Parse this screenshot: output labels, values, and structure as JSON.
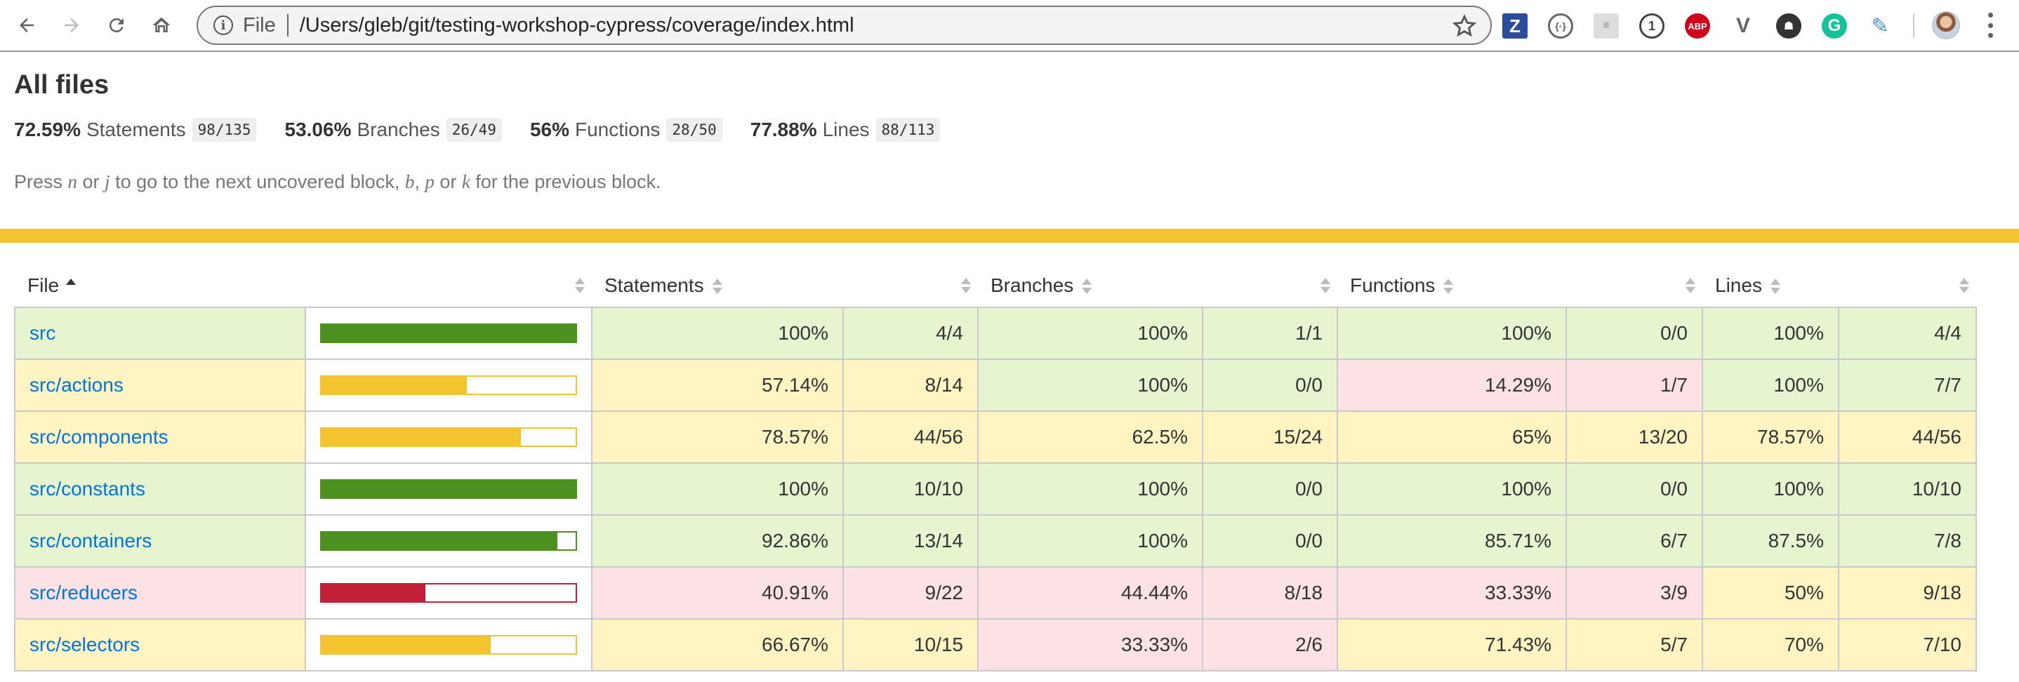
{
  "browser": {
    "scheme": "File",
    "url": "/Users/gleb/git/testing-workshop-cypress/coverage/index.html",
    "extensions": [
      "Z",
      "{·}",
      "≡",
      "1",
      "ABP",
      "V",
      "☗",
      "G",
      "✎"
    ]
  },
  "page": {
    "title": "All files",
    "summary": [
      {
        "pct": "72.59%",
        "label": "Statements",
        "fraction": "98/135"
      },
      {
        "pct": "53.06%",
        "label": "Branches",
        "fraction": "26/49"
      },
      {
        "pct": "56%",
        "label": "Functions",
        "fraction": "28/50"
      },
      {
        "pct": "77.88%",
        "label": "Lines",
        "fraction": "88/113"
      }
    ],
    "help": {
      "t1": "Press ",
      "k1": "n",
      "t2": " or ",
      "k2": "j",
      "t3": " to go to the next uncovered block, ",
      "k3": "b",
      "t4": ", ",
      "k4": "p",
      "t5": " or ",
      "k5": "k",
      "t6": " for the previous block."
    }
  },
  "table": {
    "headers": {
      "file": "File",
      "statements": "Statements",
      "branches": "Branches",
      "functions": "Functions",
      "lines": "Lines"
    },
    "rows": [
      {
        "file": "src",
        "bar_level": "high",
        "bar_pct": 100,
        "st": {
          "p": "100%",
          "f": "4/4",
          "c": "high"
        },
        "br": {
          "p": "100%",
          "f": "1/1",
          "c": "high"
        },
        "fn": {
          "p": "100%",
          "f": "0/0",
          "c": "high"
        },
        "ln": {
          "p": "100%",
          "f": "4/4",
          "c": "high"
        }
      },
      {
        "file": "src/actions",
        "bar_level": "medium",
        "bar_pct": 57.14,
        "st": {
          "p": "57.14%",
          "f": "8/14",
          "c": "medium"
        },
        "br": {
          "p": "100%",
          "f": "0/0",
          "c": "high"
        },
        "fn": {
          "p": "14.29%",
          "f": "1/7",
          "c": "low"
        },
        "ln": {
          "p": "100%",
          "f": "7/7",
          "c": "high"
        }
      },
      {
        "file": "src/components",
        "bar_level": "medium",
        "bar_pct": 78.57,
        "st": {
          "p": "78.57%",
          "f": "44/56",
          "c": "medium"
        },
        "br": {
          "p": "62.5%",
          "f": "15/24",
          "c": "medium"
        },
        "fn": {
          "p": "65%",
          "f": "13/20",
          "c": "medium"
        },
        "ln": {
          "p": "78.57%",
          "f": "44/56",
          "c": "medium"
        }
      },
      {
        "file": "src/constants",
        "bar_level": "high",
        "bar_pct": 100,
        "st": {
          "p": "100%",
          "f": "10/10",
          "c": "high"
        },
        "br": {
          "p": "100%",
          "f": "0/0",
          "c": "high"
        },
        "fn": {
          "p": "100%",
          "f": "0/0",
          "c": "high"
        },
        "ln": {
          "p": "100%",
          "f": "10/10",
          "c": "high"
        }
      },
      {
        "file": "src/containers",
        "bar_level": "high",
        "bar_pct": 92.86,
        "st": {
          "p": "92.86%",
          "f": "13/14",
          "c": "high"
        },
        "br": {
          "p": "100%",
          "f": "0/0",
          "c": "high"
        },
        "fn": {
          "p": "85.71%",
          "f": "6/7",
          "c": "high"
        },
        "ln": {
          "p": "87.5%",
          "f": "7/8",
          "c": "high"
        }
      },
      {
        "file": "src/reducers",
        "bar_level": "low",
        "bar_pct": 40.91,
        "st": {
          "p": "40.91%",
          "f": "9/22",
          "c": "low"
        },
        "br": {
          "p": "44.44%",
          "f": "8/18",
          "c": "low"
        },
        "fn": {
          "p": "33.33%",
          "f": "3/9",
          "c": "low"
        },
        "ln": {
          "p": "50%",
          "f": "9/18",
          "c": "medium"
        }
      },
      {
        "file": "src/selectors",
        "bar_level": "medium",
        "bar_pct": 66.67,
        "st": {
          "p": "66.67%",
          "f": "10/15",
          "c": "medium"
        },
        "br": {
          "p": "33.33%",
          "f": "2/6",
          "c": "low"
        },
        "fn": {
          "p": "71.43%",
          "f": "5/7",
          "c": "medium"
        },
        "ln": {
          "p": "70%",
          "f": "7/10",
          "c": "medium"
        }
      }
    ]
  }
}
